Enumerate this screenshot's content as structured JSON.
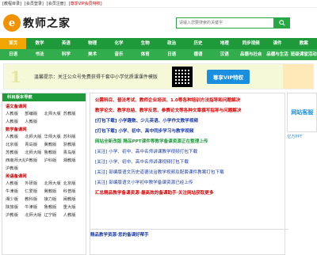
{
  "topbar": [
    "[教程目录]",
    "[会员登录]",
    "[会员注册]",
    "[尊享VIP会员特权]"
  ],
  "logo": {
    "mark": "e",
    "text": "教师之家"
  },
  "search": {
    "placeholder": "请输入您要搜索的关键字"
  },
  "nav1": [
    "首页",
    "数学",
    "英语",
    "物理",
    "化学",
    "生物",
    "政治",
    "历史",
    "地理",
    "同步视频",
    "课件",
    "教案"
  ],
  "nav2": [
    "日语",
    "书法",
    "科学",
    "美术",
    "音乐",
    "体育",
    "日语",
    "德语",
    "汉语",
    "品德与社会",
    "品德与生活",
    "班级课堂活动"
  ],
  "banner": {
    "num": "1",
    "text": "温馨提示：关注公众号免费获得千套中小学优质课课件模版",
    "vip": "尊享VIP特权"
  },
  "sidebar": {
    "title": "科目版本导航",
    "sections": [
      {
        "name": "语文备课网",
        "items": [
          "人教版",
          "部编版",
          "北师大版",
          "苏教版",
          "人教版",
          "人教版",
          "",
          ""
        ]
      },
      {
        "name": "数学备课网",
        "items": [
          "人教版",
          "北师大版",
          "华师大版",
          "苏科版",
          "北京版",
          "青岛版",
          "冀教版",
          "浙教版",
          "苏教版",
          "北师大版",
          "鲁教版",
          "青岛版",
          "西南师大版",
          "沪教版",
          "沪科版",
          "湘教版",
          "沪教版",
          "",
          "",
          ""
        ]
      },
      {
        "name": "英语备课网",
        "items": [
          "人教版",
          "外研版",
          "北师大版",
          "北京版",
          "牛津版",
          "仁爱版",
          "冀教版",
          "科普版",
          "湘少版",
          "教科版",
          "接力版",
          "闽教版",
          "陕旅版",
          "牛津版",
          "鲁教版",
          "重大版",
          "沪教版",
          "北师大版",
          "辽宁版",
          "人教版"
        ]
      }
    ]
  },
  "center": [
    {
      "cls": "red",
      "text": "公需科目、普法考试、教师企业培训、1.0等各种培训方法指导和问题解决"
    },
    {
      "cls": "red",
      "text": "教学论文、教学总结、教学反思、参赛论文等各种文章撰写指导与问题解决"
    },
    {
      "cls": "blue",
      "text": "[打包下载] 小学趣数、少儿英语、小学作文教学视频"
    },
    {
      "cls": "blue",
      "text": "[打包下载] 小学、初中、高中同步学习与教学视频"
    },
    {
      "cls": "green",
      "text": "网站全新改版 精品PPT课件等教学备课资源正在整理上传"
    },
    {
      "cls": "bl",
      "text": "[关注] 小学、初中、高中名师讲课教学视频打包下载"
    },
    {
      "cls": "bl",
      "text": "[关注] 小学、初中、高中名师讲课视频打包下载"
    },
    {
      "cls": "bl",
      "text": "[关注] 部编版语文历史道德法治教学视频及配套课件教案打包下载"
    },
    {
      "cls": "bl",
      "text": "[关注] 部编版语文小学初中教学备课资源已经上传"
    },
    {
      "cls": "red",
      "text": "汇总精品教学备课资源·最高效的备课助手·关注网站获取更多"
    }
  ],
  "right": {
    "box1": "网站客服",
    "box2": "亿万PPT"
  },
  "bottom_title": "精品教学资源·您的备课好帮手"
}
